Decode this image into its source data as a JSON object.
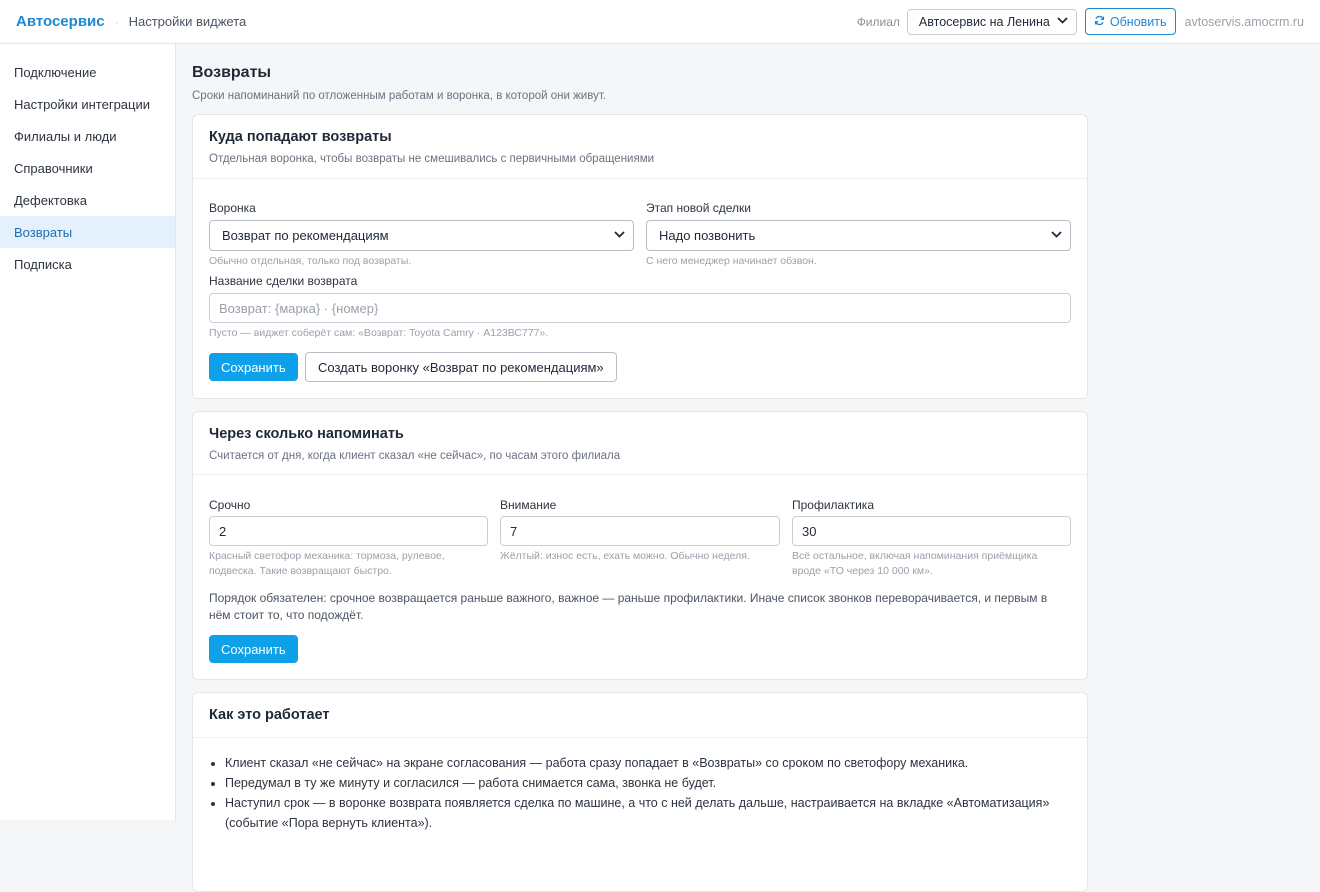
{
  "topbar": {
    "brand": "Автосервис",
    "separator": "·",
    "crumb": "Настройки виджета",
    "branch_label": "Филиал",
    "branch_value": "Автосервис на Ленина",
    "refresh_label": "Обновить",
    "domain": "avtoservis.amocrm.ru"
  },
  "sidebar": {
    "items": [
      {
        "label": "Подключение"
      },
      {
        "label": "Настройки интеграции"
      },
      {
        "label": "Филиалы и люди"
      },
      {
        "label": "Справочники"
      },
      {
        "label": "Дефектовка"
      },
      {
        "label": "Возвраты",
        "active": true
      },
      {
        "label": "Подписка"
      }
    ]
  },
  "page": {
    "title": "Возвраты",
    "subtitle": "Сроки напоминаний по отложенным работам и воронка, в которой они живут."
  },
  "card1": {
    "title": "Куда попадают возвраты",
    "subtitle": "Отдельная воронка, чтобы возвраты не смешивались с первичными обращениями",
    "pipeline_label": "Воронка",
    "pipeline_value": "Возврат по рекомендациям",
    "pipeline_hint": "Обычно отдельная, только под возвраты.",
    "stage_label": "Этап новой сделки",
    "stage_value": "Надо позвонить",
    "stage_hint": "С него менеджер начинает обзвон.",
    "name_label": "Название сделки возврата",
    "name_placeholder": "Возврат: {марка} · {номер}",
    "name_hint": "Пусто — виджет соберёт сам: «Возврат: Toyota Camry · А123ВС777».",
    "save_label": "Сохранить",
    "create_label": "Создать воронку «Возврат по рекомендациям»"
  },
  "card2": {
    "title": "Через сколько напоминать",
    "subtitle": "Считается от дня, когда клиент сказал «не сейчас», по часам этого филиала",
    "urgent_label": "Срочно",
    "urgent_value": "2",
    "urgent_hint": "Красный светофор механика: тормоза, рулевое, подвеска. Такие возвращают быстро.",
    "attention_label": "Внимание",
    "attention_value": "7",
    "attention_hint": "Жёлтый: износ есть, ехать можно. Обычно неделя.",
    "prevention_label": "Профилактика",
    "prevention_value": "30",
    "prevention_hint": "Всё остальное, включая напоминания приёмщика вроде «ТО через 10 000 км».",
    "note": "Порядок обязателен: срочное возвращается раньше важного, важное — раньше профилактики. Иначе список звонков переворачивается, и первым в нём стоит то, что подождёт.",
    "save_label": "Сохранить"
  },
  "card3": {
    "title": "Как это работает",
    "items": [
      "Клиент сказал «не сейчас» на экране согласования — работа сразу попадает в «Возвраты» со сроком по светофору механика.",
      "Передумал в ту же минуту и согласился — работа снимается сама, звонка не будет.",
      "Наступил срок — в воронке возврата появляется сделка по машине, а что с ней делать дальше, настраивается на вкладке «Автоматизация» (событие «Пора вернуть клиента»)."
    ]
  }
}
